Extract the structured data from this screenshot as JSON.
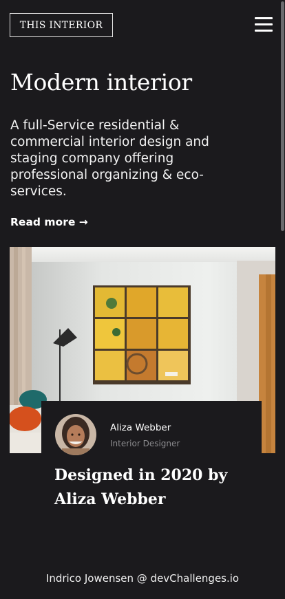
{
  "header": {
    "logo_text": "THIS INTERIOR",
    "menu_icon": "hamburger-menu-icon"
  },
  "hero": {
    "title": "Modern interior",
    "description": "A full-Service residential & commercial interior design and staging company offering professional organizing & eco-services.",
    "read_more_label": "Read more →"
  },
  "author": {
    "name": "Aliza Webber",
    "role": "Interior Designer",
    "designed_text": "Designed in 2020 by Aliza Webber"
  },
  "footer": {
    "credit": "Indrico Jowensen @ devChallenges.io"
  },
  "colors": {
    "background": "#1b1a1d",
    "text": "#ffffff",
    "muted": "#8b8b8e"
  }
}
